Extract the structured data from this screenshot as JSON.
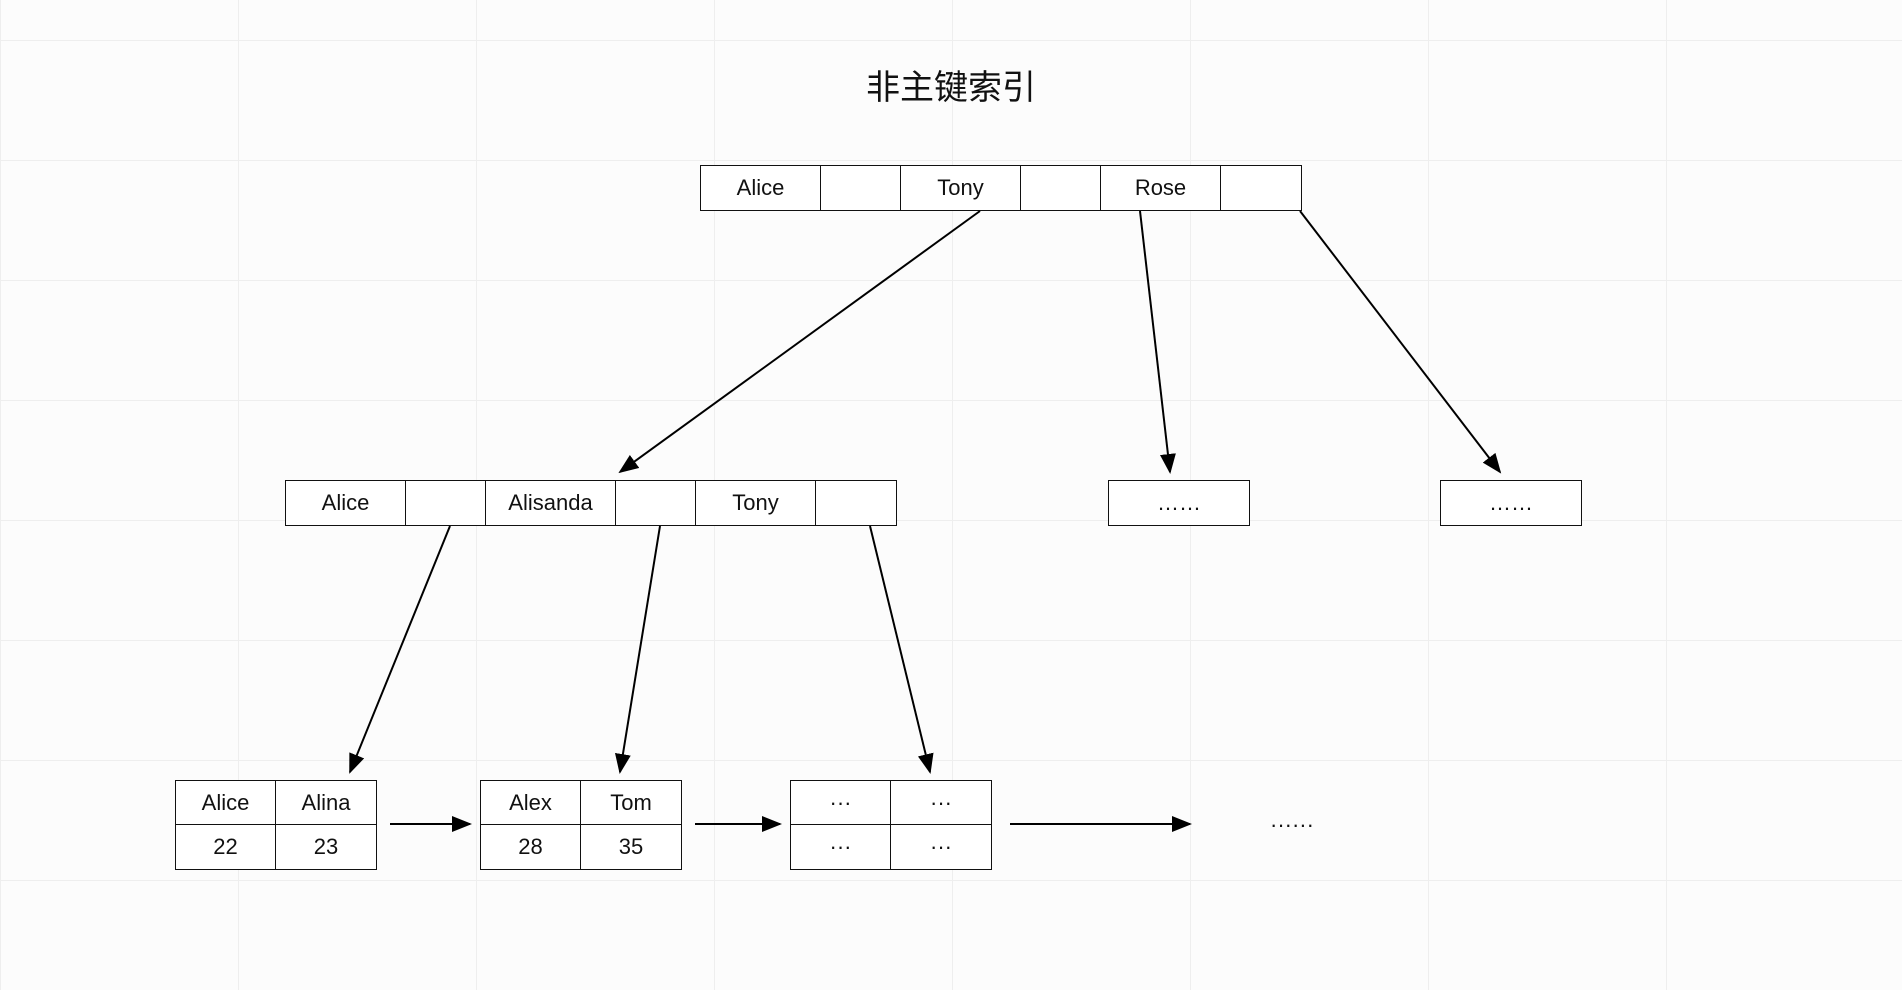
{
  "title": "非主键索引",
  "root": {
    "keys": [
      "Alice",
      "Tony",
      "Rose"
    ]
  },
  "mid": {
    "keys": [
      "Alice",
      "Alisanda",
      "Tony"
    ]
  },
  "mid_placeholder1": "……",
  "mid_placeholder2": "……",
  "leaf1": {
    "top": [
      "Alice",
      "Alina"
    ],
    "bottom": [
      "22",
      "23"
    ]
  },
  "leaf2": {
    "top": [
      "Alex",
      "Tom"
    ],
    "bottom": [
      "28",
      "35"
    ]
  },
  "leaf3": {
    "top": [
      "···",
      "···"
    ],
    "bottom": [
      "···",
      "···"
    ]
  },
  "leaf_placeholder": "······"
}
